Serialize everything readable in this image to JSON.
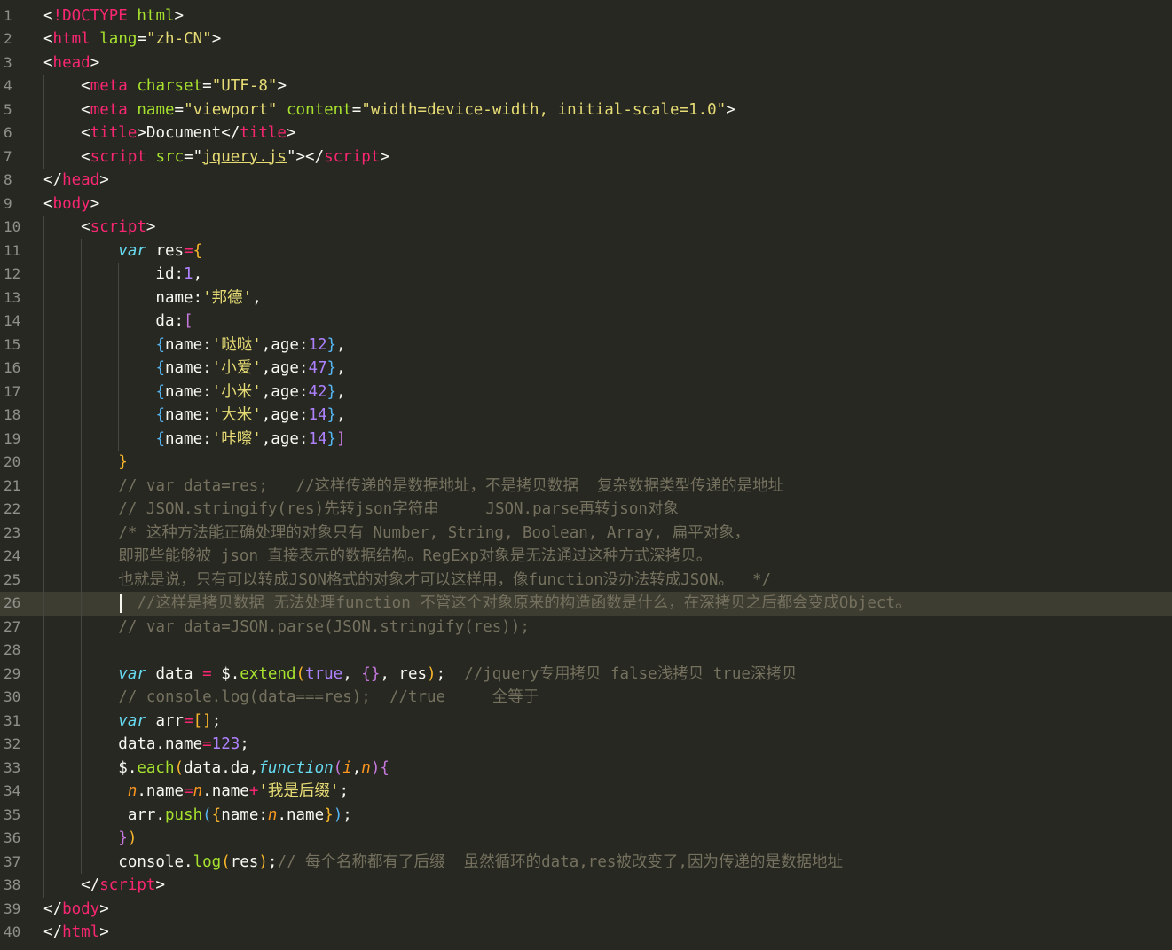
{
  "editor": {
    "theme": {
      "background": "#272822",
      "current_line": "#3e3d32",
      "gutter_text": "#8f908a"
    },
    "current_line": 26,
    "lines": [
      {
        "n": "1",
        "t": [
          [
            "<",
            "p"
          ],
          [
            "!DOCTYPE",
            "tag"
          ],
          [
            " ",
            "p"
          ],
          [
            "html",
            "attr"
          ],
          [
            ">",
            "p"
          ]
        ]
      },
      {
        "n": "2",
        "t": [
          [
            "<",
            "p"
          ],
          [
            "html",
            "tag"
          ],
          [
            " ",
            "p"
          ],
          [
            "lang",
            "attr"
          ],
          [
            "=",
            "p"
          ],
          [
            "\"zh-CN\"",
            "str"
          ],
          [
            ">",
            "p"
          ]
        ]
      },
      {
        "n": "3",
        "t": [
          [
            "<",
            "p"
          ],
          [
            "head",
            "tag"
          ],
          [
            ">",
            "p"
          ]
        ]
      },
      {
        "n": "4",
        "t": [
          [
            "    <",
            "p"
          ],
          [
            "meta",
            "tag"
          ],
          [
            " ",
            "p"
          ],
          [
            "charset",
            "attr"
          ],
          [
            "=",
            "p"
          ],
          [
            "\"UTF-8\"",
            "str"
          ],
          [
            ">",
            "p"
          ]
        ]
      },
      {
        "n": "5",
        "t": [
          [
            "    <",
            "p"
          ],
          [
            "meta",
            "tag"
          ],
          [
            " ",
            "p"
          ],
          [
            "name",
            "attr"
          ],
          [
            "=",
            "p"
          ],
          [
            "\"viewport\"",
            "str"
          ],
          [
            " ",
            "p"
          ],
          [
            "content",
            "attr"
          ],
          [
            "=",
            "p"
          ],
          [
            "\"width=device-width, initial-scale=1.0\"",
            "str"
          ],
          [
            ">",
            "p"
          ]
        ]
      },
      {
        "n": "6",
        "t": [
          [
            "    <",
            "p"
          ],
          [
            "title",
            "tag"
          ],
          [
            ">Document</",
            "p"
          ],
          [
            "title",
            "tag"
          ],
          [
            ">",
            "p"
          ]
        ]
      },
      {
        "n": "7",
        "t": [
          [
            "    <",
            "p"
          ],
          [
            "script",
            "tag"
          ],
          [
            " ",
            "p"
          ],
          [
            "src",
            "attr"
          ],
          [
            "=\"",
            "p"
          ],
          [
            "jquery.js",
            "link"
          ],
          [
            "\"></",
            "p"
          ],
          [
            "script",
            "tag"
          ],
          [
            ">",
            "p"
          ]
        ]
      },
      {
        "n": "8",
        "t": [
          [
            "</",
            "p"
          ],
          [
            "head",
            "tag"
          ],
          [
            ">",
            "p"
          ]
        ]
      },
      {
        "n": "9",
        "t": [
          [
            "<",
            "p"
          ],
          [
            "body",
            "tag"
          ],
          [
            ">",
            "p"
          ]
        ]
      },
      {
        "n": "10",
        "t": [
          [
            "    <",
            "p"
          ],
          [
            "script",
            "tag"
          ],
          [
            ">",
            "p"
          ]
        ]
      },
      {
        "n": "11",
        "t": [
          [
            "        ",
            "p"
          ],
          [
            "var",
            "kw"
          ],
          [
            " res",
            "p"
          ],
          [
            "=",
            "op"
          ],
          [
            "{",
            "b1"
          ]
        ]
      },
      {
        "n": "12",
        "t": [
          [
            "            id:",
            "p"
          ],
          [
            "1",
            "num"
          ],
          [
            ",",
            "p"
          ]
        ]
      },
      {
        "n": "13",
        "t": [
          [
            "            name:",
            "p"
          ],
          [
            "'邦德'",
            "str"
          ],
          [
            ",",
            "p"
          ]
        ]
      },
      {
        "n": "14",
        "t": [
          [
            "            da:",
            "p"
          ],
          [
            "[",
            "b2"
          ]
        ]
      },
      {
        "n": "15",
        "t": [
          [
            "            ",
            "p"
          ],
          [
            "{",
            "b3"
          ],
          [
            "name:",
            "p"
          ],
          [
            "'哒哒'",
            "str"
          ],
          [
            ",age:",
            "p"
          ],
          [
            "12",
            "num"
          ],
          [
            "}",
            "b3"
          ],
          [
            ",",
            "p"
          ]
        ]
      },
      {
        "n": "16",
        "t": [
          [
            "            ",
            "p"
          ],
          [
            "{",
            "b3"
          ],
          [
            "name:",
            "p"
          ],
          [
            "'小爱'",
            "str"
          ],
          [
            ",age:",
            "p"
          ],
          [
            "47",
            "num"
          ],
          [
            "}",
            "b3"
          ],
          [
            ",",
            "p"
          ]
        ]
      },
      {
        "n": "17",
        "t": [
          [
            "            ",
            "p"
          ],
          [
            "{",
            "b3"
          ],
          [
            "name:",
            "p"
          ],
          [
            "'小米'",
            "str"
          ],
          [
            ",age:",
            "p"
          ],
          [
            "42",
            "num"
          ],
          [
            "}",
            "b3"
          ],
          [
            ",",
            "p"
          ]
        ]
      },
      {
        "n": "18",
        "t": [
          [
            "            ",
            "p"
          ],
          [
            "{",
            "b3"
          ],
          [
            "name:",
            "p"
          ],
          [
            "'大米'",
            "str"
          ],
          [
            ",age:",
            "p"
          ],
          [
            "14",
            "num"
          ],
          [
            "}",
            "b3"
          ],
          [
            ",",
            "p"
          ]
        ]
      },
      {
        "n": "19",
        "t": [
          [
            "            ",
            "p"
          ],
          [
            "{",
            "b3"
          ],
          [
            "name:",
            "p"
          ],
          [
            "'咔嚓'",
            "str"
          ],
          [
            ",age:",
            "p"
          ],
          [
            "14",
            "num"
          ],
          [
            "}",
            "b3"
          ],
          [
            "]",
            "b2"
          ]
        ]
      },
      {
        "n": "20",
        "t": [
          [
            "        ",
            "p"
          ],
          [
            "}",
            "b1"
          ]
        ]
      },
      {
        "n": "21",
        "t": [
          [
            "        ",
            "p"
          ],
          [
            "// var data=res;   //这样传递的是数据地址，不是拷贝数据  复杂数据类型传递的是地址",
            "cmt"
          ]
        ]
      },
      {
        "n": "22",
        "t": [
          [
            "        ",
            "p"
          ],
          [
            "// JSON.stringify(res)先转json字符串     JSON.parse再转json对象",
            "cmt"
          ]
        ]
      },
      {
        "n": "23",
        "t": [
          [
            "        ",
            "p"
          ],
          [
            "/* 这种方法能正确处理的对象只有 Number, String, Boolean, Array, 扁平对象，",
            "cmt"
          ]
        ]
      },
      {
        "n": "24",
        "t": [
          [
            "        ",
            "p"
          ],
          [
            "即那些能够被 json 直接表示的数据结构。RegExp对象是无法通过这种方式深拷贝。",
            "cmt"
          ]
        ]
      },
      {
        "n": "25",
        "t": [
          [
            "        ",
            "p"
          ],
          [
            "也就是说，只有可以转成JSON格式的对象才可以这样用，像function没办法转成JSON。  */",
            "cmt"
          ]
        ]
      },
      {
        "n": "26",
        "t": [
          [
            "          ",
            "p"
          ],
          [
            "//这样是拷贝数据 无法处理function 不管这个对象原来的构造函数是什么，在深拷贝之后都会变成Object。",
            "cmt"
          ]
        ]
      },
      {
        "n": "27",
        "t": [
          [
            "        ",
            "p"
          ],
          [
            "// var data=JSON.parse(JSON.stringify(res));",
            "cmt"
          ]
        ]
      },
      {
        "n": "28",
        "t": []
      },
      {
        "n": "29",
        "t": [
          [
            "        ",
            "p"
          ],
          [
            "var",
            "kw"
          ],
          [
            " data ",
            "p"
          ],
          [
            "=",
            "op"
          ],
          [
            " $.",
            "p"
          ],
          [
            "extend",
            "fn"
          ],
          [
            "(",
            "b1"
          ],
          [
            "true",
            "lit"
          ],
          [
            ", ",
            "p"
          ],
          [
            "{}",
            "b2"
          ],
          [
            ", res",
            "p"
          ],
          [
            ")",
            "b1"
          ],
          [
            ";  ",
            "p"
          ],
          [
            "//jquery专用拷贝 false浅拷贝 true深拷贝",
            "cmt"
          ]
        ]
      },
      {
        "n": "30",
        "t": [
          [
            "        ",
            "p"
          ],
          [
            "// console.log(data===res);  //true     全等于",
            "cmt"
          ]
        ]
      },
      {
        "n": "31",
        "t": [
          [
            "        ",
            "p"
          ],
          [
            "var",
            "kw"
          ],
          [
            " arr",
            "p"
          ],
          [
            "=",
            "op"
          ],
          [
            "[]",
            "b1"
          ],
          [
            ";",
            "p"
          ]
        ]
      },
      {
        "n": "32",
        "t": [
          [
            "        data.name",
            "p"
          ],
          [
            "=",
            "op"
          ],
          [
            "123",
            "num"
          ],
          [
            ";",
            "p"
          ]
        ]
      },
      {
        "n": "33",
        "t": [
          [
            "        $.",
            "p"
          ],
          [
            "each",
            "fn"
          ],
          [
            "(",
            "b1"
          ],
          [
            "data.da,",
            "p"
          ],
          [
            "function",
            "kw"
          ],
          [
            "(",
            "b2"
          ],
          [
            "i",
            "param"
          ],
          [
            ",",
            "p"
          ],
          [
            "n",
            "param"
          ],
          [
            ")",
            "b2"
          ],
          [
            "{",
            "b2"
          ]
        ]
      },
      {
        "n": "34",
        "t": [
          [
            "         ",
            "p"
          ],
          [
            "n",
            "param"
          ],
          [
            ".name",
            "p"
          ],
          [
            "=",
            "op"
          ],
          [
            "n",
            "param"
          ],
          [
            ".name",
            "p"
          ],
          [
            "+",
            "op"
          ],
          [
            "'我是后缀'",
            "str"
          ],
          [
            ";",
            "p"
          ]
        ]
      },
      {
        "n": "35",
        "t": [
          [
            "         arr.",
            "p"
          ],
          [
            "push",
            "fn"
          ],
          [
            "(",
            "b3"
          ],
          [
            "{",
            "b1"
          ],
          [
            "name:",
            "p"
          ],
          [
            "n",
            "param"
          ],
          [
            ".name",
            "p"
          ],
          [
            "}",
            "b1"
          ],
          [
            ")",
            "b3"
          ],
          [
            ";",
            "p"
          ]
        ]
      },
      {
        "n": "36",
        "t": [
          [
            "        ",
            "p"
          ],
          [
            "}",
            "b2"
          ],
          [
            ")",
            "b1"
          ]
        ]
      },
      {
        "n": "37",
        "t": [
          [
            "        console.",
            "p"
          ],
          [
            "log",
            "fn"
          ],
          [
            "(",
            "b1"
          ],
          [
            "res",
            "p"
          ],
          [
            ")",
            "b1"
          ],
          [
            ";",
            "p"
          ],
          [
            "// 每个名称都有了后缀  虽然循环的data,res被改变了,因为传递的是数据地址",
            "cmt"
          ]
        ]
      },
      {
        "n": "38",
        "t": [
          [
            "    </",
            "p"
          ],
          [
            "script",
            "tag"
          ],
          [
            ">",
            "p"
          ]
        ]
      },
      {
        "n": "39",
        "t": [
          [
            "</",
            "p"
          ],
          [
            "body",
            "tag"
          ],
          [
            ">",
            "p"
          ]
        ]
      },
      {
        "n": "40",
        "t": [
          [
            "</",
            "p"
          ],
          [
            "html",
            "tag"
          ],
          [
            ">",
            "p"
          ]
        ]
      }
    ]
  }
}
